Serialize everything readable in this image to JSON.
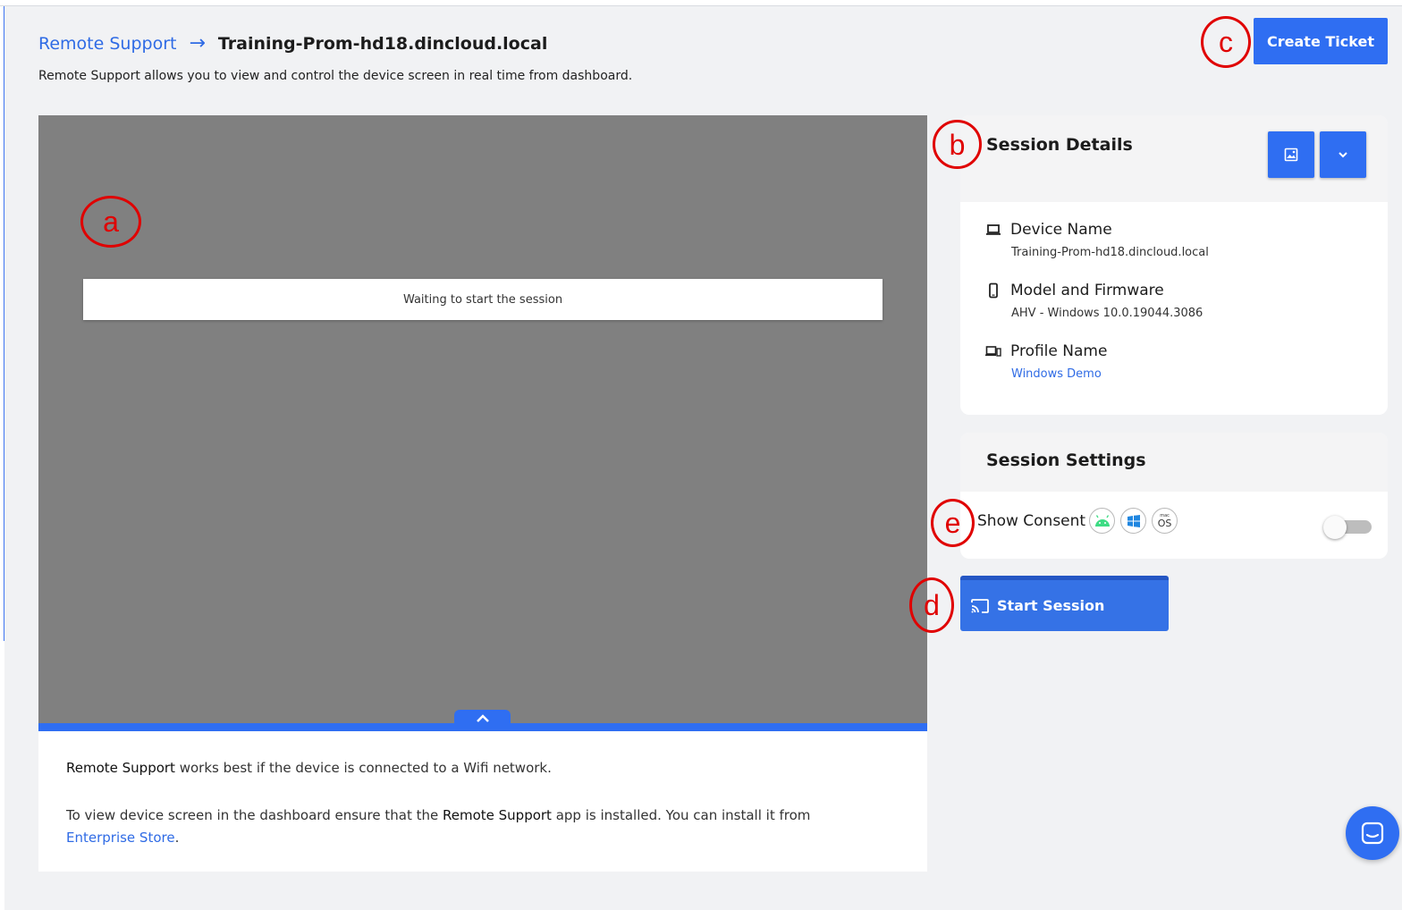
{
  "breadcrumb": {
    "parent": "Remote Support",
    "arrow": "→",
    "current": "Training-Prom-hd18.dincloud.local"
  },
  "subtitle": "Remote Support allows you to view and control the device screen in real time from dashboard.",
  "header": {
    "create_ticket_label": "Create Ticket"
  },
  "viewer": {
    "status_text": "Waiting to start the session"
  },
  "info": {
    "p1_strong": "Remote Support",
    "p1_rest": " works best if the device is connected to a Wifi network.",
    "p2_start": "To view device screen in the dashboard ensure that the ",
    "p2_strong": "Remote Support",
    "p2_mid": " app is installed. You can install it from ",
    "p2_link": "Enterprise Store",
    "p2_end": "."
  },
  "session_details": {
    "title": "Session Details",
    "device_name_label": "Device Name",
    "device_name_value": "Training-Prom-hd18.dincloud.local",
    "model_label": "Model and Firmware",
    "model_value": "AHV - Windows 10.0.19044.3086",
    "profile_label": "Profile Name",
    "profile_value": "Windows Demo"
  },
  "session_settings": {
    "title": "Session Settings",
    "show_consent_label": "Show Consent",
    "consent_enabled": false,
    "os_icons": [
      "android-icon",
      "windows-icon",
      "macos-icon"
    ],
    "macos_badge_top": "mac",
    "macos_badge_bottom": "OS"
  },
  "start_session_label": "Start Session",
  "annotations": {
    "a": "a",
    "b": "b",
    "c": "c",
    "d": "d",
    "e": "e"
  },
  "colors": {
    "accent": "#2f6ef2",
    "annotation": "#e00000",
    "viewer_bg": "#808080"
  }
}
